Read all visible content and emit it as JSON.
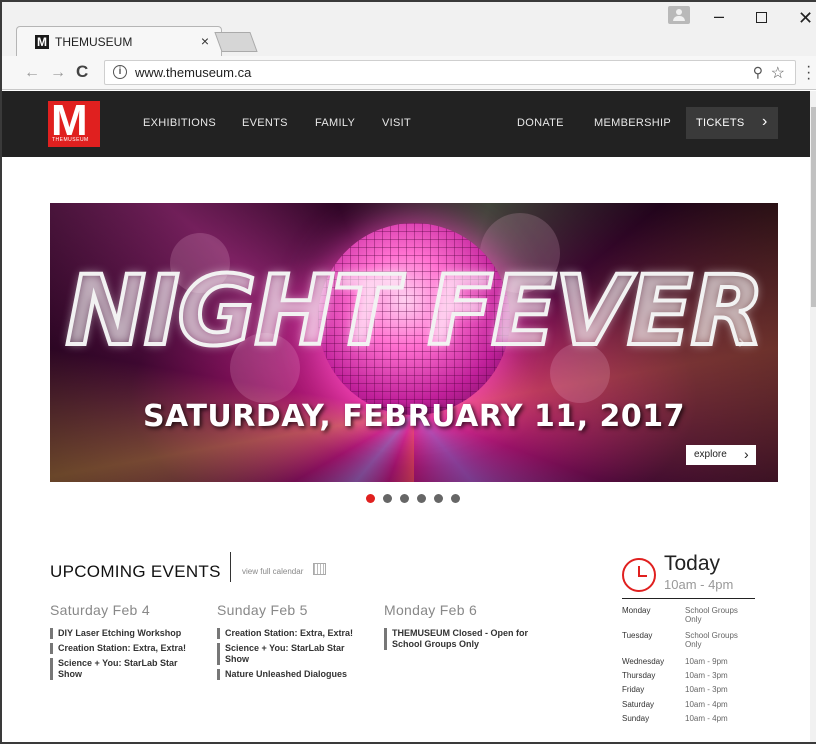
{
  "browser": {
    "tab_title": "THEMUSEUM",
    "tab_close": "×",
    "url": "www.themuseum.ca",
    "info_icon": "ⓘ",
    "window_min": "–",
    "window_close": "✕"
  },
  "site": {
    "logo_letter": "M",
    "logo_caption": "THEMUSEUM",
    "nav": {
      "exhibitions": "EXHIBITIONS",
      "events": "EVENTS",
      "family": "FAMILY",
      "visit": "VISIT",
      "donate": "DONATE",
      "membership": "MEMBERSHIP",
      "tickets": "TICKETS"
    },
    "brand_color": "#e0201f"
  },
  "hero": {
    "headline": "NIGHT FEVER",
    "date_line": "SATURDAY, FEBRUARY 11, 2017",
    "explore_label": "explore",
    "slide_count": 6,
    "active_slide": 1
  },
  "events": {
    "title": "UPCOMING EVENTS",
    "calendar_link": "view full calendar",
    "days": [
      {
        "title": "Saturday Feb 4",
        "items": [
          "DIY Laser Etching Workshop",
          "Creation Station: Extra, Extra!",
          "Science + You: StarLab Star Show"
        ]
      },
      {
        "title": "Sunday Feb 5",
        "items": [
          "Creation Station: Extra, Extra!",
          "Science + You: StarLab Star Show",
          "Nature Unleashed Dialogues"
        ]
      },
      {
        "title": "Monday Feb 6",
        "items": [
          "THEMUSEUM Closed - Open for School Groups Only"
        ]
      }
    ]
  },
  "today": {
    "title": "Today",
    "hours": "10am - 4pm",
    "schedule": [
      {
        "day": "Monday",
        "time": "School Groups Only"
      },
      {
        "day": "Tuesday",
        "time": "School Groups Only"
      },
      {
        "day": "Wednesday",
        "time": "10am - 9pm"
      },
      {
        "day": "Thursday",
        "time": "10am - 3pm"
      },
      {
        "day": "Friday",
        "time": "10am - 3pm"
      },
      {
        "day": "Saturday",
        "time": "10am - 4pm"
      },
      {
        "day": "Sunday",
        "time": "10am - 4pm"
      }
    ]
  }
}
